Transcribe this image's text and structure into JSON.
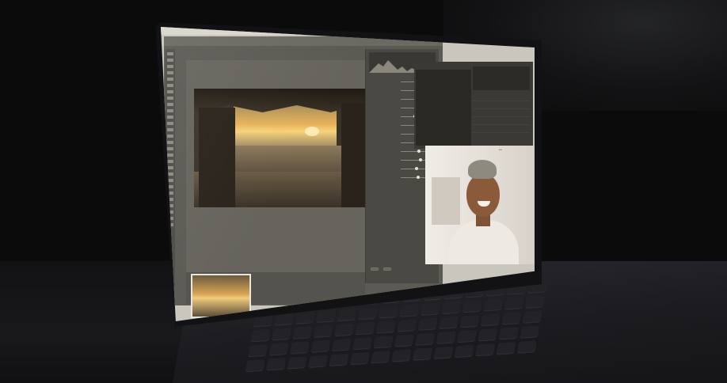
{
  "scene": {
    "subject": "laptop-screen-with-photo-editor-and-video-call",
    "colors": {
      "background": "#0b0b0c",
      "screen": "#c9c6bd",
      "editor_panel": "#4b4944",
      "sunset": "#e7b35a"
    }
  },
  "editor": {
    "panel": {
      "buttons": [
        "",
        ""
      ]
    },
    "sliders": [
      {
        "level": 0.5
      },
      {
        "level": 0.62
      },
      {
        "level": 0.45
      },
      {
        "level": 0.55
      },
      {
        "level": 0.4
      },
      {
        "level": 0.6
      },
      {
        "level": 0.5
      },
      {
        "level": 0.48
      },
      {
        "level": 0.52
      },
      {
        "level": 0.58
      },
      {
        "level": 0.44
      },
      {
        "level": 0.5
      }
    ]
  },
  "icons": [
    "tool-icon",
    "cursor-icon"
  ]
}
